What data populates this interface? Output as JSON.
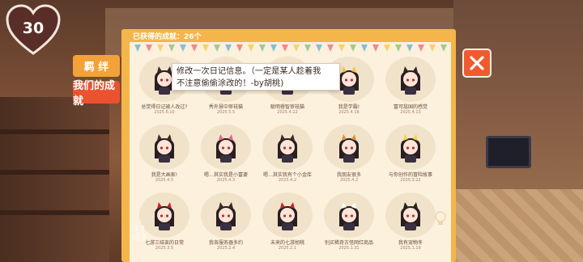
{
  "hud": {
    "affection_level": "30"
  },
  "tabs": [
    {
      "label": "羁 绊",
      "active": false
    },
    {
      "label": "我们的成就",
      "active": true
    }
  ],
  "panel": {
    "header": "已获得的成就：26个"
  },
  "tooltip": {
    "text_line1": "修改一次日记信息。（一定是某人趁着我",
    "text_line2": "不注意偷偷涂改的！-by胡桃)"
  },
  "achievements": [
    {
      "title": "总觉得日记被人改过?",
      "date": "2025.6.10",
      "variant": "cat-ears"
    },
    {
      "title": "秀外慧中审祛猫",
      "date": "2025.5.5",
      "variant": "plain"
    },
    {
      "title": "聪明睿智审祛猫",
      "date": "2025.4.22",
      "variant": "horns-pink"
    },
    {
      "title": "我是学霸!",
      "date": "2025.4.16",
      "variant": "star"
    },
    {
      "title": "富可敌国的感觉",
      "date": "2025.4.13",
      "variant": "demon"
    },
    {
      "title": "我是大画家!",
      "date": "2025.4.5",
      "variant": "cat-ears"
    },
    {
      "title": "嗯…其实我是小富婆",
      "date": "2025.4.3",
      "variant": "horns-pink"
    },
    {
      "title": "嗯…其实我有个小金库",
      "date": "2025.4.2",
      "variant": "cat-ears"
    },
    {
      "title": "我朋友很多",
      "date": "2025.4.2",
      "variant": "drink"
    },
    {
      "title": "与你创作的冒险故事",
      "date": "2025.3.22",
      "variant": "halo"
    },
    {
      "title": "七游三结束的日常",
      "date": "2025.3.5",
      "variant": "horns-red"
    },
    {
      "title": "我各服务器多约",
      "date": "2025.2.4",
      "variant": "cat-ears"
    },
    {
      "title": "未来的七游胡桃",
      "date": "2025.2.1",
      "variant": "horns-red"
    },
    {
      "title": "别买稀奇古怪网红商品",
      "date": "2025.1.31",
      "variant": "mask"
    },
    {
      "title": "我有宠物冬",
      "date": "2025.1.19",
      "variant": "dark"
    }
  ],
  "colors": {
    "panel": "#f4b54a",
    "inner": "#fbf1dd",
    "tab_active": "#ea5230",
    "tab": "#f3a23a",
    "close": "#f05a2c"
  },
  "icons": {
    "heart": "heart-icon",
    "close": "close-x-icon",
    "bulb": "lightbulb-icon",
    "bunny": "bunny-icon"
  }
}
